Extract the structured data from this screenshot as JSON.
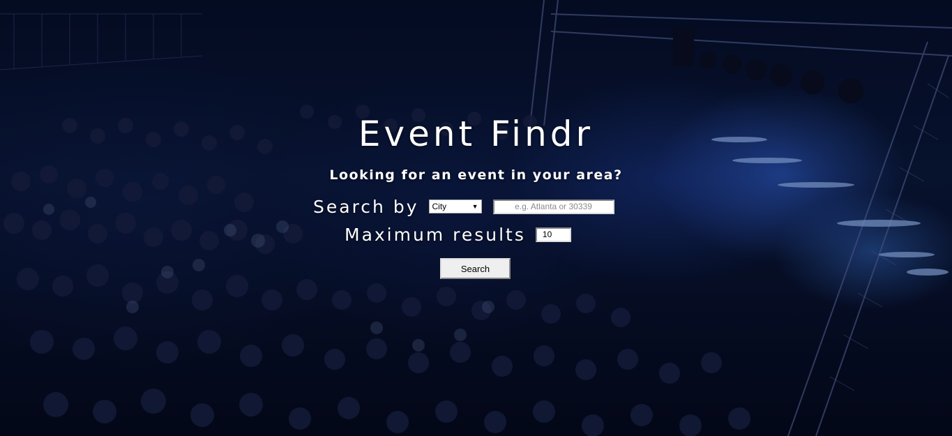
{
  "header": {
    "title": "Event Findr",
    "subtitle": "Looking for an event in your area?"
  },
  "search_form": {
    "search_by_label": "Search by",
    "search_by_select": {
      "selected": "City",
      "options": [
        "City"
      ]
    },
    "location_input": {
      "value": "",
      "placeholder": "e.g. Atlanta or 30339"
    },
    "max_results_label": "Maximum results",
    "max_results_input": {
      "value": "10"
    },
    "submit_label": "Search"
  },
  "theme": {
    "background_description_color": "#0a1838",
    "accent_light": "#3c78ff",
    "text_color": "#ffffff"
  }
}
